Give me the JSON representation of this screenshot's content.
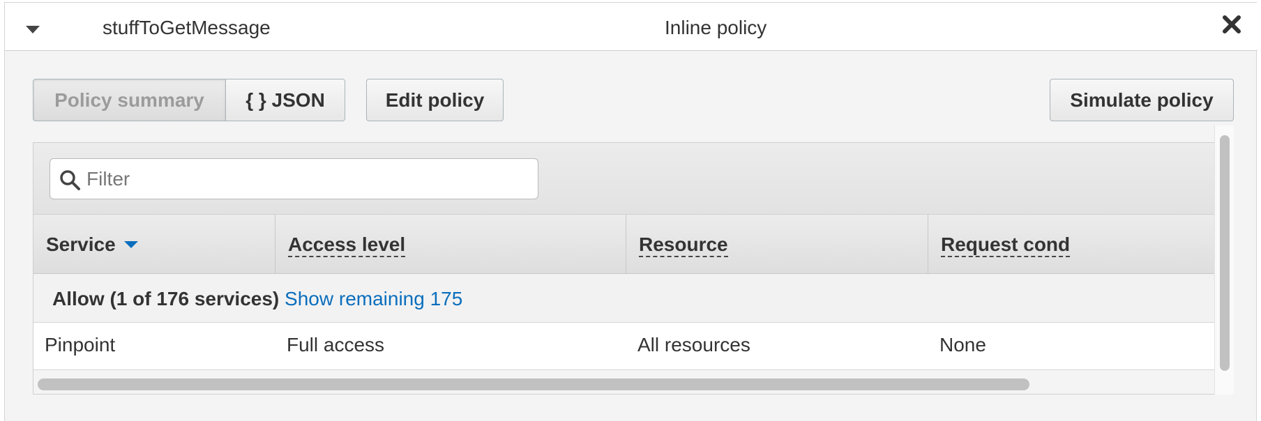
{
  "header": {
    "policy_name": "stuffToGetMessage",
    "policy_type": "Inline policy"
  },
  "toolbar": {
    "summary_label": "Policy summary",
    "json_label": "{ } JSON",
    "edit_label": "Edit policy",
    "simulate_label": "Simulate policy"
  },
  "filter": {
    "placeholder": "Filter",
    "value": ""
  },
  "table": {
    "columns": [
      "Service",
      "Access level",
      "Resource",
      "Request cond"
    ],
    "group": {
      "label": "Allow (1 of 176 services)",
      "link": "Show remaining 175"
    },
    "rows": [
      {
        "service": "Pinpoint",
        "access_level": "Full access",
        "resource": "All resources",
        "request_condition": "None"
      }
    ]
  },
  "colors": {
    "link": "#0a6ebd",
    "panel_bg": "#f4f4f4"
  },
  "icons": {
    "collapse": "caret-down-icon",
    "close": "close-icon",
    "filter": "search-icon",
    "sort": "sort-down-icon"
  }
}
